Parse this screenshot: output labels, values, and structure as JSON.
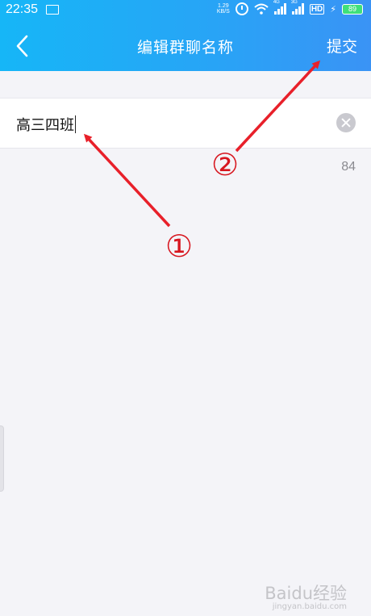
{
  "status_bar": {
    "time": "22:35",
    "net_speed_value": "1.29",
    "net_speed_unit": "KB/S",
    "signal_1_tag": "4G",
    "signal_2_tag": "3G",
    "hd_label": "HD",
    "battery_level": "89"
  },
  "header": {
    "title": "编辑群聊名称",
    "submit_label": "提交",
    "back_icon": "chevron-left-icon"
  },
  "form": {
    "group_name_value": "高三四班",
    "remaining_chars": "84",
    "clear_icon": "clear-circle-icon"
  },
  "annotations": {
    "marker_1": "①",
    "marker_2": "②",
    "arrow_color": "#e8202a"
  },
  "watermark": {
    "text": "Baidu经验",
    "sub": "jingyan.baidu.com"
  }
}
